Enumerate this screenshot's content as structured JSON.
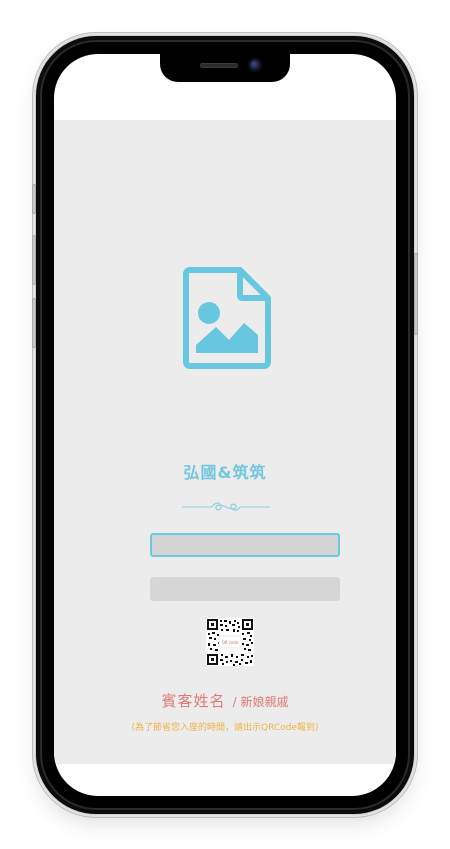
{
  "invite": {
    "couple_names": "弘國&筑筑",
    "guest_label": "賓客姓名",
    "guest_sub": "/ 新娘親戚",
    "hint": "(為了節省您入座的時間，請出示QRCode報到)"
  },
  "form": {
    "guest_name_value": "",
    "secondary_value": ""
  },
  "qr": {
    "center_text": "QR code"
  },
  "colors": {
    "accent": "#72c7dd",
    "guest": "#e07a73",
    "hint": "#f0b245",
    "screen_bg": "#ececec"
  },
  "icons": {
    "photo_placeholder": "image-file-icon",
    "divider": "ornament-divider"
  }
}
